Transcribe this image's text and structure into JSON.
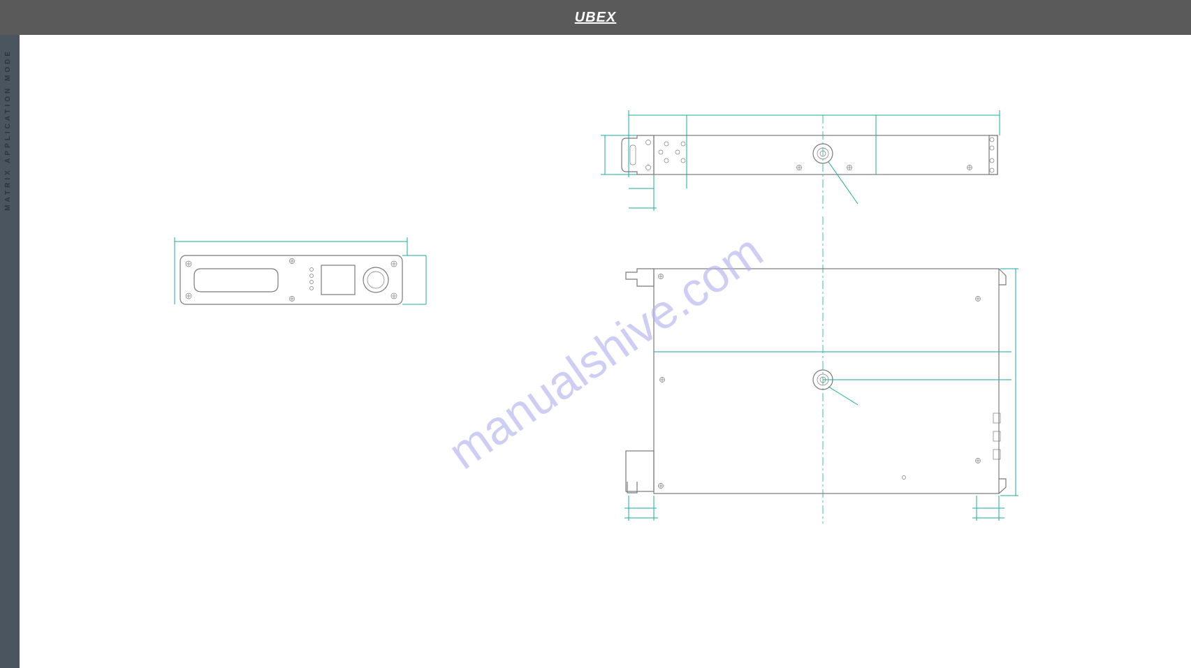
{
  "header": {
    "logo": "UBEX"
  },
  "sidebar": {
    "text": "MATRIX APPLICATION MODE"
  },
  "watermark": "manualshive.com",
  "drawing": {
    "title": "Technical mechanical drawing — device enclosure, three views",
    "views": {
      "front": "Front panel view with display window, indicator LEDs, secondary display and rotary dial",
      "side": "Side view with mounting flange and threaded inserts",
      "top": "Top view with mounting bracket and chassis outline"
    },
    "dimension_lines_color": "#1aa9a0",
    "outline_color": "#7a7a7a"
  }
}
